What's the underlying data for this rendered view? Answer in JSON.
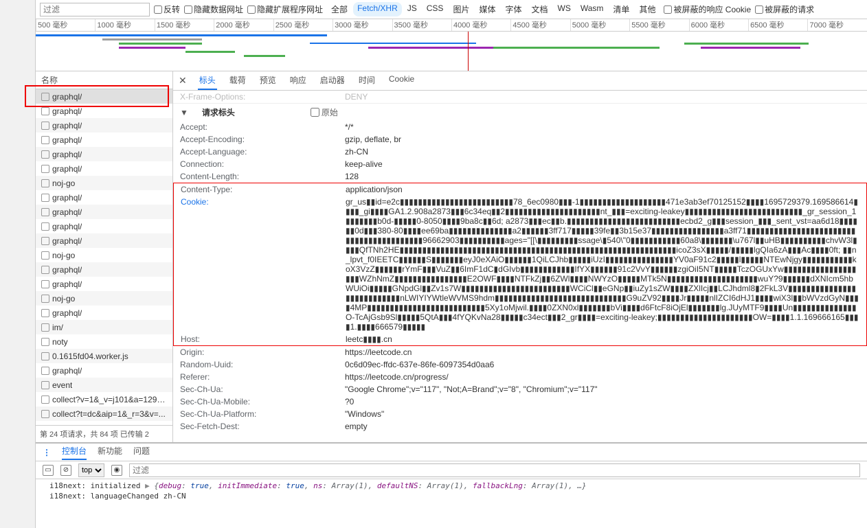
{
  "topbar": {
    "filter_placeholder": "过滤",
    "invert": "反转",
    "hide_data": "隐藏数据网址",
    "hide_ext": "隐藏扩展程序网址",
    "filters": [
      "全部",
      "Fetch/XHR",
      "JS",
      "CSS",
      "图片",
      "媒体",
      "字体",
      "文档",
      "WS",
      "Wasm",
      "清单",
      "其他"
    ],
    "active_filter": 1,
    "blocked_cookie": "被屏蔽的响应 Cookie",
    "blocked_req": "被屏蔽的请求"
  },
  "timeline": {
    "ticks": [
      "500 毫秒",
      "1000 毫秒",
      "1500 毫秒",
      "2000 毫秒",
      "2500 毫秒",
      "3000 毫秒",
      "3500 毫秒",
      "4000 毫秒",
      "4500 毫秒",
      "5000 毫秒",
      "5500 毫秒",
      "6000 毫秒",
      "6500 毫秒",
      "7000 毫秒"
    ]
  },
  "requests": {
    "header": "名称",
    "items": [
      "graphql/",
      "graphql/",
      "graphql/",
      "graphql/",
      "graphql/",
      "graphql/",
      "noj-go",
      "graphql/",
      "graphql/",
      "graphql/",
      "graphql/",
      "noj-go",
      "graphql/",
      "graphql/",
      "noj-go",
      "graphql/",
      "im/",
      "noty",
      "0.1615fd04.worker.js",
      "graphql/",
      "event",
      "collect?v=1&_v=j101&a=1299...",
      "collect?t=dc&aip=1&_r=3&v=..."
    ],
    "footer": "第 24 项请求，共 84 项     已传输 2"
  },
  "tabs": [
    "标头",
    "载荷",
    "预览",
    "响应",
    "启动器",
    "时间",
    "Cookie"
  ],
  "active_tab": 0,
  "xframe": {
    "k": "X-Frame-Options:",
    "v": "DENY"
  },
  "section_title": "请求标头",
  "raw_label": "原始",
  "headers_before": [
    {
      "k": "Accept:",
      "v": "*/*"
    },
    {
      "k": "Accept-Encoding:",
      "v": "gzip, deflate, br"
    },
    {
      "k": "Accept-Language:",
      "v": "zh-CN"
    },
    {
      "k": "Connection:",
      "v": "keep-alive"
    },
    {
      "k": "Content-Length:",
      "v": "128"
    }
  ],
  "headers_box": [
    {
      "k": "Content-Type:",
      "v": "application/json"
    },
    {
      "k": "Cookie:",
      "v": "gr_us▮▮id=e2c▮▮▮▮▮▮▮▮▮▮▮▮▮▮▮▮▮▮▮▮▮▮▮▮▮78_6ec0980▮▮▮-1▮▮▮▮▮▮▮▮▮▮▮▮▮▮▮▮▮▮▮471e3ab3ef70125152▮▮▮▮1695729379.169586614▮▮▮▮_gi▮▮▮▮GA1.2.908a2873▮▮▮6c34eq▮▮2▮▮▮▮▮▮▮▮▮▮▮▮▮▮▮▮▮▮▮▮▮nt_▮▮▮=exciting-leakey▮▮▮▮▮▮▮▮▮▮▮▮▮▮▮▮▮▮▮▮▮▮▮▮▮▮_gr_session_1▮▮▮▮▮▮▮b0d-▮▮▮▮▮0-8050▮▮▮▮9ba8c▮▮6d; a2873▮▮▮ec▮▮b.▮▮▮▮▮▮▮▮▮▮▮▮▮▮▮▮▮▮▮▮▮▮▮▮▮ecbd2_g▮▮▮session_▮▮▮_sent_vst=aa6d18▮▮▮▮▮▮0d▮▮▮380-80▮▮▮▮ee69ba▮▮▮▮▮▮▮▮▮▮▮▮▮▮a2▮▮▮▮▮▮3ff717▮▮▮▮▮39fe▮▮3b15e37▮▮▮▮▮▮▮▮▮▮▮▮▮▮▮▮a3ff71▮▮▮▮▮▮▮▮▮▮▮▮▮▮▮▮▮▮▮▮▮▮▮▮▮▮▮▮▮▮▮▮▮▮▮▮▮▮▮▮▮96662903▮▮▮▮▮▮▮▮▮▮ages=\"[[\\▮▮▮▮▮▮▮▮▮ssage\\▮540\\\"0▮▮▮▮▮▮▮▮▮▮▮60a8\\▮▮▮▮▮▮▮\\u767l▮▮uHB▮▮▮▮▮▮▮▮▮▮chvW3l▮▮▮▮QfTNh2HE▮▮▮▮▮▮▮▮▮▮▮▮▮▮▮▮▮▮▮▮▮▮▮▮▮▮▮▮▮▮▮▮▮▮▮▮▮▮▮▮▮▮▮▮▮▮▮▮▮▮▮▮▮▮▮▮▮▮▮▮▮icoZ3sX▮▮▮▮▮/▮▮▮▮▮lgQIa6zA▮▮▮Ac▮▮▮▮0ft; ▮▮n_lpvt_f0IEETC▮▮▮▮▮▮S▮▮▮▮▮▮▮eyJ0eXAiO▮▮▮▮▮▮1QiLCJhb▮▮▮▮▮iUzI▮▮▮▮▮▮▮▮▮▮▮▮▮▮▮YV0aF91c2▮▮▮▮▮l▮▮▮▮▮NTEwNjgy▮▮▮▮▮▮▮▮▮▮▮koX3VzZ▮▮▮▮▮▮rYmF▮▮▮VuZ▮▮6ImF1dC▮dGIvb▮▮▮▮▮▮▮▮▮▮▮▮IfYX▮▮▮▮▮▮91c2VvY▮▮▮▮▮▮zgiOiI5NT▮▮▮▮▮TczOGUxYw▮▮▮▮▮▮▮▮▮▮▮▮▮▮▮▮▮▮▮WZhNmZ▮▮▮▮▮▮▮▮▮▮▮▮▮▮▮▮E2OWF▮▮▮▮NTFkZj▮▮6ZWl▮▮▮▮NWYzO▮▮▮▮▮MTk5N▮▮▮▮▮▮▮▮▮▮▮▮▮▮▮▮▮▮▮▮wuY?9▮▮▮▮▮▮dXNIcm5hbWUiOi▮▮▮▮▮GNpdGl▮▮Zv1s7W▮▮▮▮▮▮▮▮▮▮▮▮▮▮▮▮▮▮▮▮▮▮▮▮WCiCl▮▮eGNp▮▮iuZy1sZW▮▮▮▮ZXlIcj▮▮LCJhdml8▮2FkL3V▮▮▮▮▮▮▮▮▮▮▮▮▮▮▮▮▮▮▮▮▮▮▮▮▮▮▮nLWIYIYWtleWVMS9hdm▮▮▮▮▮▮▮▮▮▮▮▮▮▮▮▮▮▮▮▮▮▮▮▮▮▮▮▮▮G9uZV92▮▮▮▮Jr▮▮▮▮▮nlIZCI6dHJ1▮▮▮▮wiX3l▮▮bWVzdGyN▮▮▮▮4MP▮▮▮▮▮▮▮▮▮▮▮▮▮▮▮▮▮▮▮▮▮▮▮▮▮▮5Xy1oMjwil.▮▮▮▮0ZXN0xl▮▮▮▮▮▮▮bVi▮▮▮▮d6FtcF8iOjEl▮▮▮▮▮▮▮lg.JUyMTF9▮▮▮▮Un▮▮▮▮▮▮▮▮▮▮▮▮▮▮O-TcAjGsb9Sl▮▮▮▮▮5QtA▮▮▮4fYQKvNa28▮▮▮▮▮c34ect▮▮▮2_gr▮▮▮▮=exciting-leakey;▮▮▮▮▮▮▮▮▮▮▮▮▮▮▮▮▮▮▮▮▮OW=▮▮▮▮1.1.169666165▮▮▮▮1.▮▮▮▮666579▮▮▮▮▮",
      "cookie": true
    },
    {
      "k": "Host:",
      "v": "leetc▮▮▮▮.cn"
    }
  ],
  "headers_after": [
    {
      "k": "Origin:",
      "v": "https://leetcode.cn"
    },
    {
      "k": "Random-Uuid:",
      "v": "0c6d09ec-ffdc-637e-86fe-6097354d0aa6"
    },
    {
      "k": "Referer:",
      "v": "https://leetcode.cn/progress/"
    },
    {
      "k": "Sec-Ch-Ua:",
      "v": "\"Google Chrome\";v=\"117\", \"Not;A=Brand\";v=\"8\", \"Chromium\";v=\"117\""
    },
    {
      "k": "Sec-Ch-Ua-Mobile:",
      "v": "?0"
    },
    {
      "k": "Sec-Ch-Ua-Platform:",
      "v": "\"Windows\""
    },
    {
      "k": "Sec-Fetch-Dest:",
      "v": "empty"
    }
  ],
  "console": {
    "tabs": [
      "控制台",
      "新功能",
      "问题"
    ],
    "top_label": "top",
    "filter_placeholder": "过滤",
    "logs": [
      {
        "prefix": "i18next: initialized",
        "expand": true,
        "obj": "{debug: true, initImmediate: true, ns: Array(1), defaultNS: Array(1), fallbackLng: Array(1), …}"
      },
      {
        "prefix": "i18next: languageChanged zh-CN"
      }
    ]
  }
}
